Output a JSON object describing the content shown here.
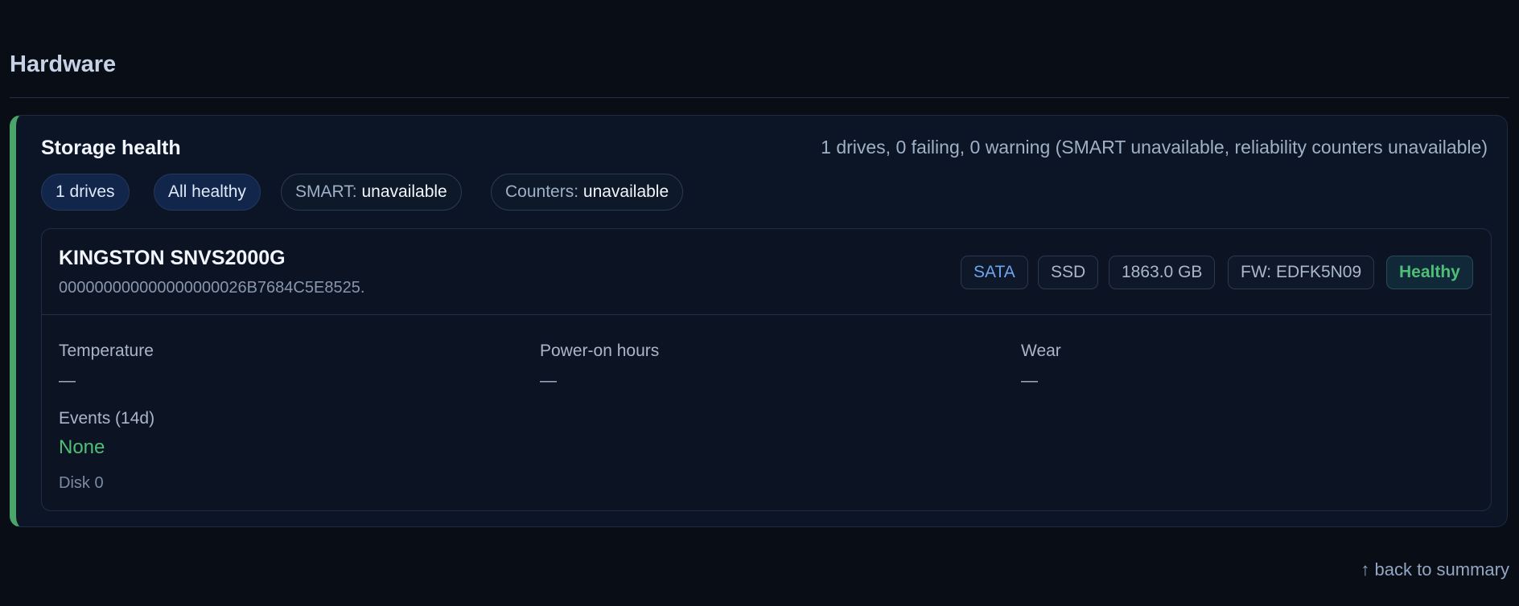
{
  "section": {
    "title": "Hardware"
  },
  "storage": {
    "title": "Storage health",
    "summary": "1 drives, 0 failing, 0 warning (SMART unavailable, reliability counters unavailable)",
    "pills": {
      "drives": "1 drives",
      "healthy": "All healthy",
      "smart_label": "SMART:",
      "smart_value": "unavailable",
      "counters_label": "Counters:",
      "counters_value": "unavailable"
    },
    "accent_color": "#4aa56b"
  },
  "drive": {
    "model": "KINGSTON SNVS2000G",
    "serial": "000000000000000000026B7684C5E8525.",
    "tags": {
      "interface": "SATA",
      "type": "SSD",
      "size": "1863.0 GB",
      "firmware": "FW: EDFK5N09",
      "status": "Healthy"
    },
    "metrics": {
      "temperature_label": "Temperature",
      "temperature_value": "—",
      "power_on_label": "Power-on hours",
      "power_on_value": "—",
      "wear_label": "Wear",
      "wear_value": "—",
      "events_label": "Events (14d)",
      "events_value": "None"
    },
    "disk_label": "Disk 0",
    "status_color": "#4fbf78"
  },
  "footer": {
    "back_link": "↑ back to summary"
  }
}
